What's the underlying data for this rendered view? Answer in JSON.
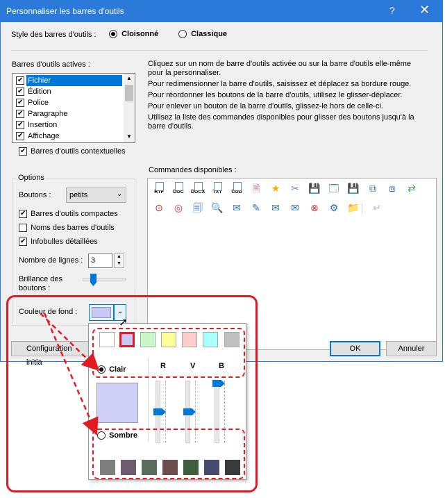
{
  "window": {
    "title": "Personnaliser les barres d'outils",
    "help": "?",
    "close": "✕"
  },
  "style_row": {
    "label": "Style des barres d'outils :",
    "option1": "Cloisonné",
    "option2": "Classique"
  },
  "active_toolbars": {
    "label": "Barres d'outils actives :",
    "items": [
      "Fichier",
      "Édition",
      "Police",
      "Paragraphe",
      "Insertion",
      "Affichage"
    ],
    "contextual": "Barres d'outils contextuelles"
  },
  "instructions": [
    "Cliquez sur un nom de barre d'outils activée ou sur la barre d'outils elle-même pour la personnaliser.",
    "Pour redimensionner la barre d'outils, saisissez et déplacez sa bordure rouge.",
    "Pour réordonner les boutons de la barre d'outils, utilisez le glisser-déplacer.",
    "Pour enlever un bouton de la barre d'outils, glissez-le hors de celle-ci.",
    "Utilisez la liste des commandes disponibles pour glisser des boutons jusqu'à la barre d'outils."
  ],
  "options": {
    "title": "Options",
    "buttons_label": "Boutons :",
    "buttons_value": "petits",
    "compact": "Barres d'outils compactes",
    "names": "Noms des barres d'outils",
    "tooltips": "Infobulles détaillées",
    "lines_label": "Nombre de lignes :",
    "lines_value": "3",
    "brightness_label": "Brillance des boutons :",
    "bg_label": "Couleur de fond :"
  },
  "commands": {
    "label": "Commandes disponibles :",
    "doc_icons": [
      "RTF",
      "DOC",
      "DOCX",
      "TXT",
      "COD"
    ]
  },
  "footer": {
    "config": "Configuration initia",
    "ok": "OK",
    "cancel": "Annuler"
  },
  "popup": {
    "light_label": "Clair",
    "dark_label": "Sombre",
    "r": "R",
    "v": "V",
    "b": "B",
    "light_swatches": [
      "#ffffff",
      "#c8c8f8",
      "#c8f8c8",
      "#ffff99",
      "#ffcccc",
      "#aaffff",
      "#c0c0c0"
    ],
    "dark_swatches": [
      "#7f7f7f",
      "#6e5b6e",
      "#5b6e5b",
      "#6e4d4d",
      "#3f5f3f",
      "#4a4a6e",
      "#3a3a3a"
    ],
    "preview_color": "#d0d0f8"
  },
  "colors": {
    "accent": "#0078d7",
    "highlight": "#e21b23"
  }
}
